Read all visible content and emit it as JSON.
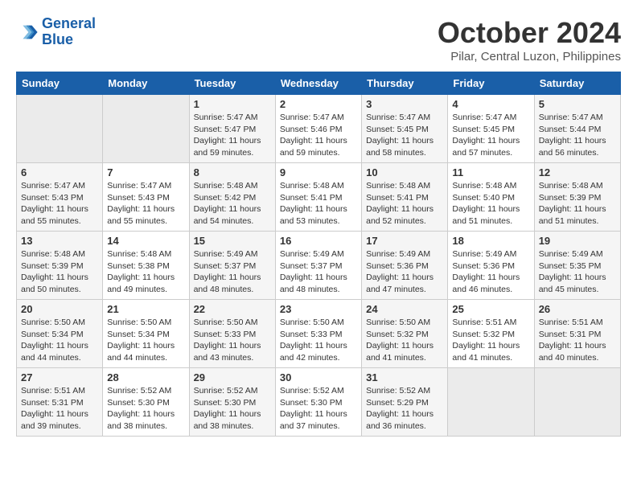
{
  "logo": {
    "line1": "General",
    "line2": "Blue"
  },
  "title": "October 2024",
  "location": "Pilar, Central Luzon, Philippines",
  "weekdays": [
    "Sunday",
    "Monday",
    "Tuesday",
    "Wednesday",
    "Thursday",
    "Friday",
    "Saturday"
  ],
  "weeks": [
    [
      {
        "day": "",
        "sunrise": "",
        "sunset": "",
        "daylight": ""
      },
      {
        "day": "",
        "sunrise": "",
        "sunset": "",
        "daylight": ""
      },
      {
        "day": "1",
        "sunrise": "Sunrise: 5:47 AM",
        "sunset": "Sunset: 5:47 PM",
        "daylight": "Daylight: 11 hours and 59 minutes."
      },
      {
        "day": "2",
        "sunrise": "Sunrise: 5:47 AM",
        "sunset": "Sunset: 5:46 PM",
        "daylight": "Daylight: 11 hours and 59 minutes."
      },
      {
        "day": "3",
        "sunrise": "Sunrise: 5:47 AM",
        "sunset": "Sunset: 5:45 PM",
        "daylight": "Daylight: 11 hours and 58 minutes."
      },
      {
        "day": "4",
        "sunrise": "Sunrise: 5:47 AM",
        "sunset": "Sunset: 5:45 PM",
        "daylight": "Daylight: 11 hours and 57 minutes."
      },
      {
        "day": "5",
        "sunrise": "Sunrise: 5:47 AM",
        "sunset": "Sunset: 5:44 PM",
        "daylight": "Daylight: 11 hours and 56 minutes."
      }
    ],
    [
      {
        "day": "6",
        "sunrise": "Sunrise: 5:47 AM",
        "sunset": "Sunset: 5:43 PM",
        "daylight": "Daylight: 11 hours and 55 minutes."
      },
      {
        "day": "7",
        "sunrise": "Sunrise: 5:47 AM",
        "sunset": "Sunset: 5:43 PM",
        "daylight": "Daylight: 11 hours and 55 minutes."
      },
      {
        "day": "8",
        "sunrise": "Sunrise: 5:48 AM",
        "sunset": "Sunset: 5:42 PM",
        "daylight": "Daylight: 11 hours and 54 minutes."
      },
      {
        "day": "9",
        "sunrise": "Sunrise: 5:48 AM",
        "sunset": "Sunset: 5:41 PM",
        "daylight": "Daylight: 11 hours and 53 minutes."
      },
      {
        "day": "10",
        "sunrise": "Sunrise: 5:48 AM",
        "sunset": "Sunset: 5:41 PM",
        "daylight": "Daylight: 11 hours and 52 minutes."
      },
      {
        "day": "11",
        "sunrise": "Sunrise: 5:48 AM",
        "sunset": "Sunset: 5:40 PM",
        "daylight": "Daylight: 11 hours and 51 minutes."
      },
      {
        "day": "12",
        "sunrise": "Sunrise: 5:48 AM",
        "sunset": "Sunset: 5:39 PM",
        "daylight": "Daylight: 11 hours and 51 minutes."
      }
    ],
    [
      {
        "day": "13",
        "sunrise": "Sunrise: 5:48 AM",
        "sunset": "Sunset: 5:39 PM",
        "daylight": "Daylight: 11 hours and 50 minutes."
      },
      {
        "day": "14",
        "sunrise": "Sunrise: 5:48 AM",
        "sunset": "Sunset: 5:38 PM",
        "daylight": "Daylight: 11 hours and 49 minutes."
      },
      {
        "day": "15",
        "sunrise": "Sunrise: 5:49 AM",
        "sunset": "Sunset: 5:37 PM",
        "daylight": "Daylight: 11 hours and 48 minutes."
      },
      {
        "day": "16",
        "sunrise": "Sunrise: 5:49 AM",
        "sunset": "Sunset: 5:37 PM",
        "daylight": "Daylight: 11 hours and 48 minutes."
      },
      {
        "day": "17",
        "sunrise": "Sunrise: 5:49 AM",
        "sunset": "Sunset: 5:36 PM",
        "daylight": "Daylight: 11 hours and 47 minutes."
      },
      {
        "day": "18",
        "sunrise": "Sunrise: 5:49 AM",
        "sunset": "Sunset: 5:36 PM",
        "daylight": "Daylight: 11 hours and 46 minutes."
      },
      {
        "day": "19",
        "sunrise": "Sunrise: 5:49 AM",
        "sunset": "Sunset: 5:35 PM",
        "daylight": "Daylight: 11 hours and 45 minutes."
      }
    ],
    [
      {
        "day": "20",
        "sunrise": "Sunrise: 5:50 AM",
        "sunset": "Sunset: 5:34 PM",
        "daylight": "Daylight: 11 hours and 44 minutes."
      },
      {
        "day": "21",
        "sunrise": "Sunrise: 5:50 AM",
        "sunset": "Sunset: 5:34 PM",
        "daylight": "Daylight: 11 hours and 44 minutes."
      },
      {
        "day": "22",
        "sunrise": "Sunrise: 5:50 AM",
        "sunset": "Sunset: 5:33 PM",
        "daylight": "Daylight: 11 hours and 43 minutes."
      },
      {
        "day": "23",
        "sunrise": "Sunrise: 5:50 AM",
        "sunset": "Sunset: 5:33 PM",
        "daylight": "Daylight: 11 hours and 42 minutes."
      },
      {
        "day": "24",
        "sunrise": "Sunrise: 5:50 AM",
        "sunset": "Sunset: 5:32 PM",
        "daylight": "Daylight: 11 hours and 41 minutes."
      },
      {
        "day": "25",
        "sunrise": "Sunrise: 5:51 AM",
        "sunset": "Sunset: 5:32 PM",
        "daylight": "Daylight: 11 hours and 41 minutes."
      },
      {
        "day": "26",
        "sunrise": "Sunrise: 5:51 AM",
        "sunset": "Sunset: 5:31 PM",
        "daylight": "Daylight: 11 hours and 40 minutes."
      }
    ],
    [
      {
        "day": "27",
        "sunrise": "Sunrise: 5:51 AM",
        "sunset": "Sunset: 5:31 PM",
        "daylight": "Daylight: 11 hours and 39 minutes."
      },
      {
        "day": "28",
        "sunrise": "Sunrise: 5:52 AM",
        "sunset": "Sunset: 5:30 PM",
        "daylight": "Daylight: 11 hours and 38 minutes."
      },
      {
        "day": "29",
        "sunrise": "Sunrise: 5:52 AM",
        "sunset": "Sunset: 5:30 PM",
        "daylight": "Daylight: 11 hours and 38 minutes."
      },
      {
        "day": "30",
        "sunrise": "Sunrise: 5:52 AM",
        "sunset": "Sunset: 5:30 PM",
        "daylight": "Daylight: 11 hours and 37 minutes."
      },
      {
        "day": "31",
        "sunrise": "Sunrise: 5:52 AM",
        "sunset": "Sunset: 5:29 PM",
        "daylight": "Daylight: 11 hours and 36 minutes."
      },
      {
        "day": "",
        "sunrise": "",
        "sunset": "",
        "daylight": ""
      },
      {
        "day": "",
        "sunrise": "",
        "sunset": "",
        "daylight": ""
      }
    ]
  ]
}
